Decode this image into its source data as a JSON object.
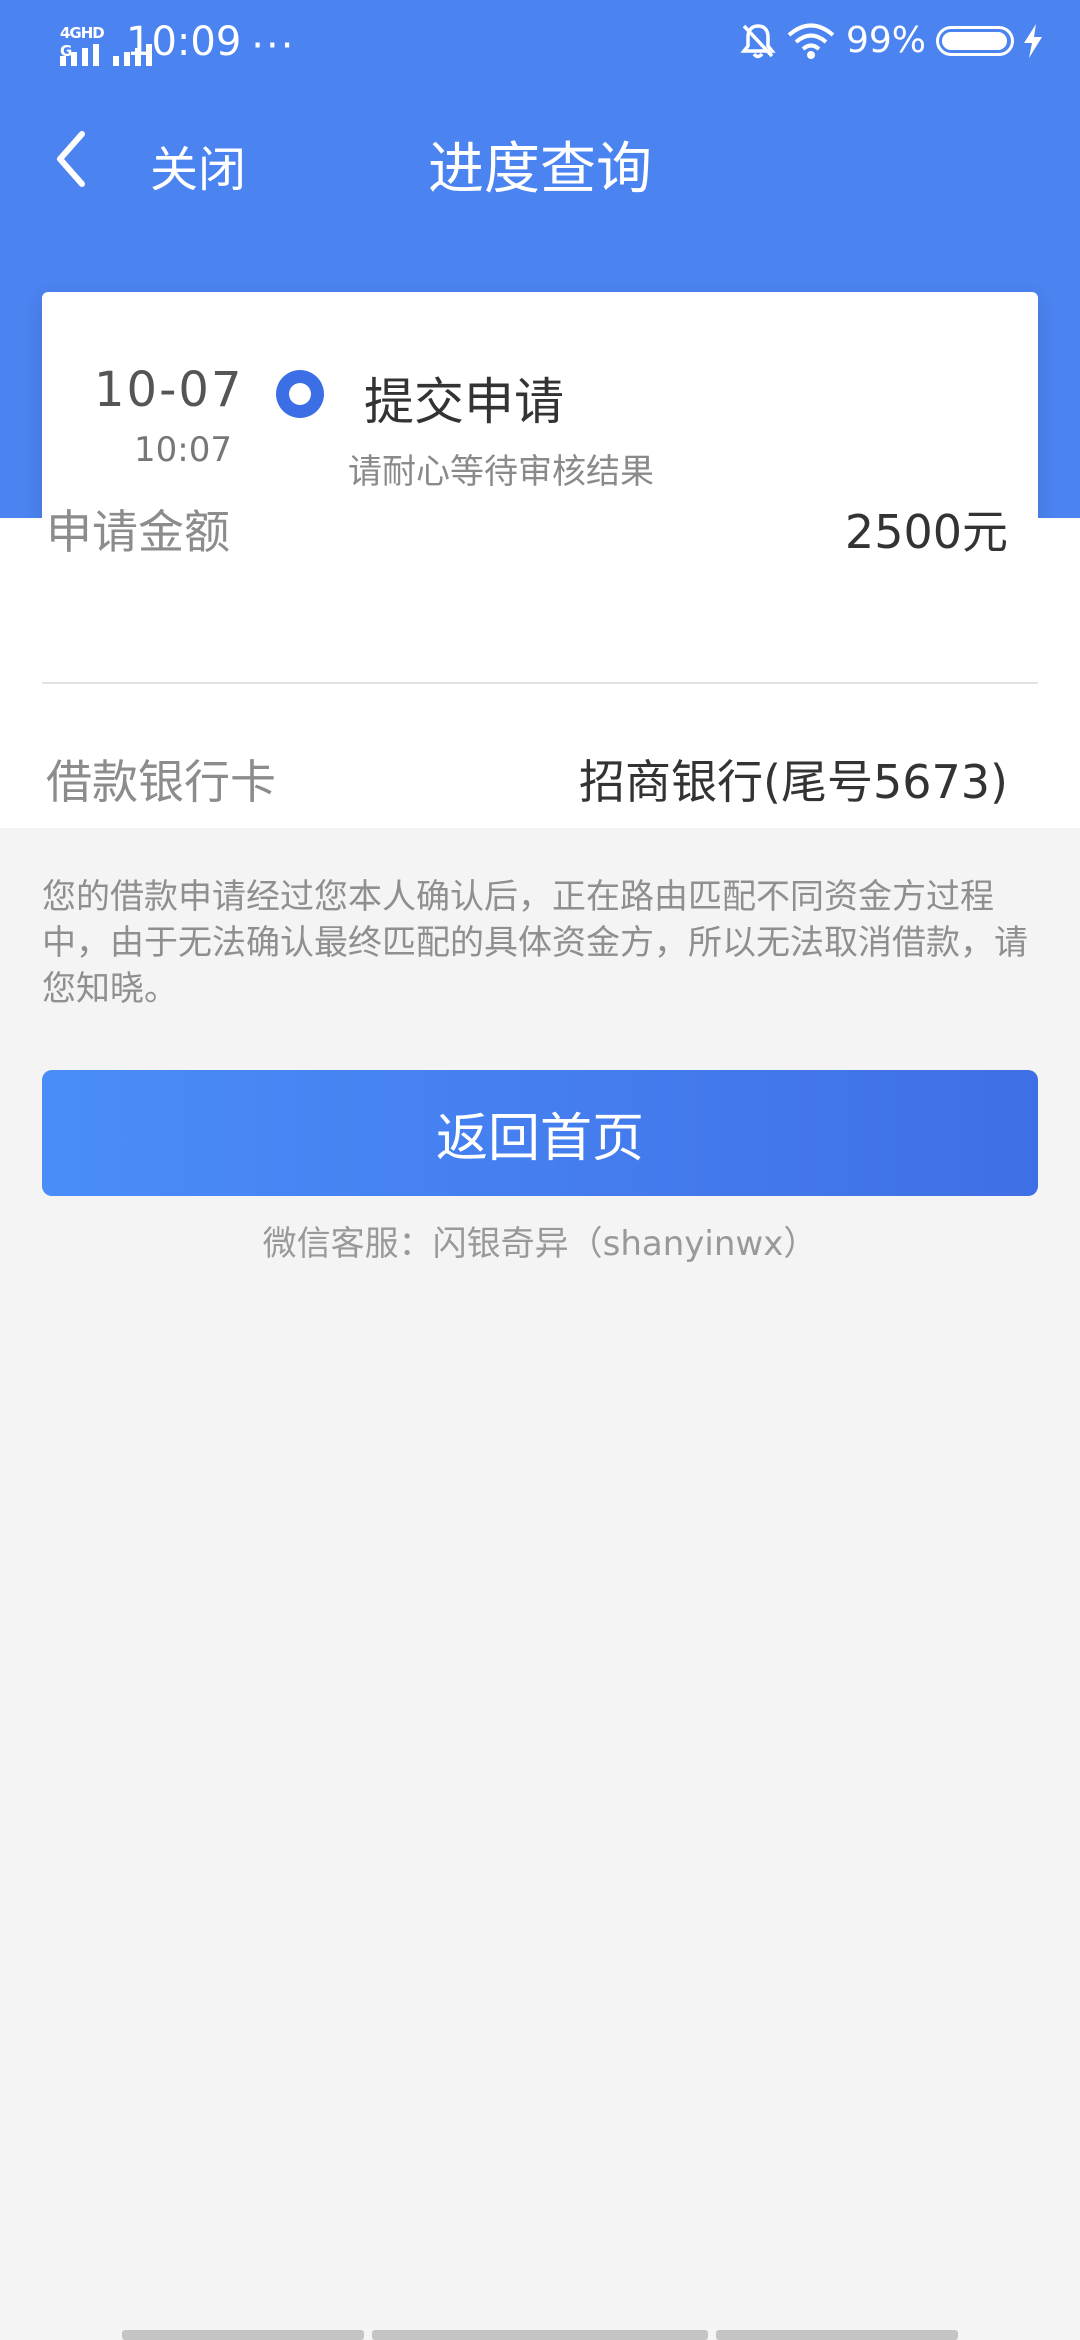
{
  "status_bar": {
    "network_label": "4GHD G",
    "time": "10:09",
    "dots": "···",
    "battery_pct": "99%",
    "icons": [
      "signal-icon",
      "mute-bell-icon",
      "wifi-icon",
      "battery-icon",
      "charging-icon"
    ]
  },
  "nav": {
    "back_icon": "chevron-left-icon",
    "close_label": "关闭",
    "title": "进度查询"
  },
  "progress": {
    "date": "10-07",
    "time": "10:07",
    "step_title": "提交申请",
    "step_subtitle": "请耐心等待审核结果"
  },
  "details": {
    "amount_label": "申请金额",
    "amount_value": "2500元",
    "card_label": "借款银行卡",
    "card_value": "招商银行(尾号5673)"
  },
  "notice": "您的借款申请经过您本人确认后，正在路由匹配不同资金方过程中，由于无法确认最终匹配的具体资金方，所以无法取消借款，请您知晓。",
  "actions": {
    "home_button_label": "返回首页"
  },
  "support": "微信客服：闪银奇异（shanyinwx）",
  "colors": {
    "primary": "#4b83f0",
    "progress_dot": "#3c6ee6",
    "button_start": "#4a8df8",
    "button_end": "#3f6fe6",
    "background": "#f4f4f4"
  }
}
